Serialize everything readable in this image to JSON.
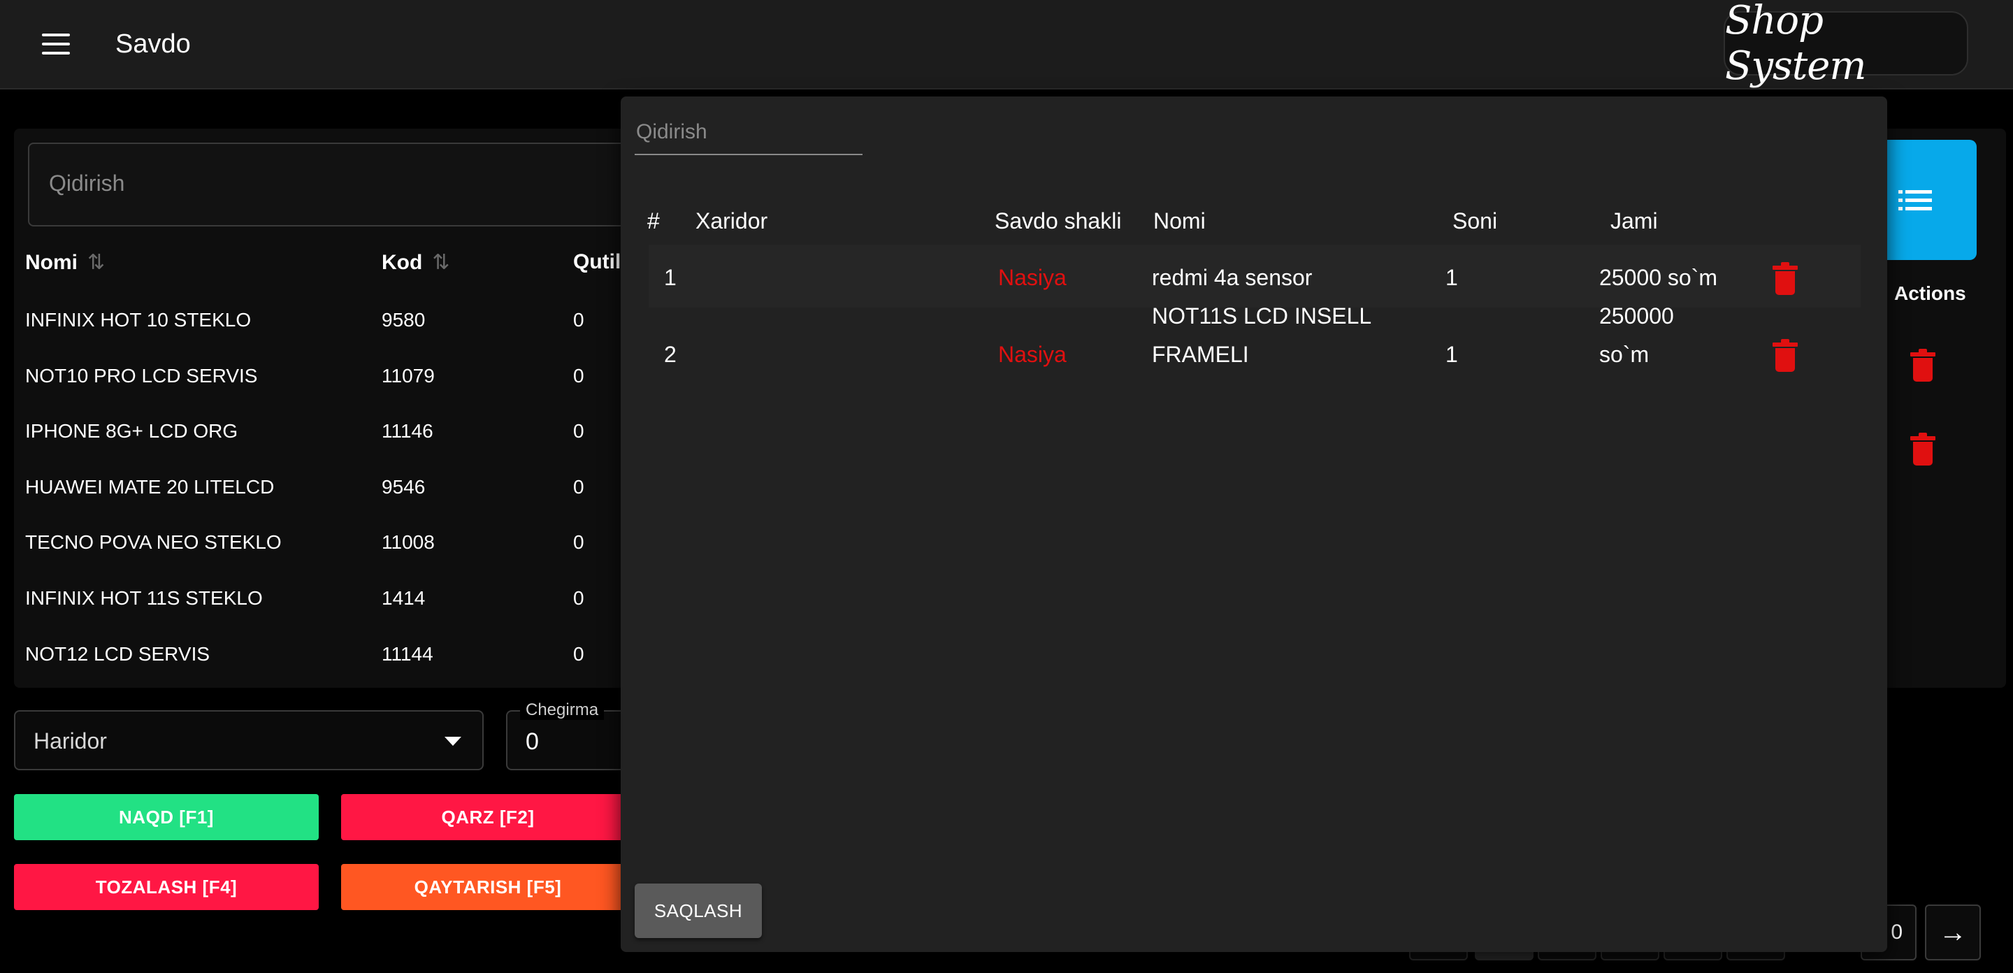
{
  "header": {
    "title": "Savdo",
    "logo_text": "Shop System"
  },
  "products": {
    "search_placeholder": "Qidirish",
    "columns": [
      "Nomi",
      "Kod",
      "Qutil"
    ],
    "rows": [
      {
        "name": "INFINIX HOT 10 STEKLO",
        "code": "9580",
        "qty": "0"
      },
      {
        "name": "NOT10 PRO LCD SERVIS",
        "code": "11079",
        "qty": "0"
      },
      {
        "name": "IPHONE 8G+ LCD ORG",
        "code": "11146",
        "qty": "0"
      },
      {
        "name": "HUAWEI MATE 20 LITELCD",
        "code": "9546",
        "qty": "0"
      },
      {
        "name": "TECNO POVA NEO STEKLO",
        "code": "11008",
        "qty": "0"
      },
      {
        "name": "INFINIX HOT 11S STEKLO",
        "code": "1414",
        "qty": "0"
      },
      {
        "name": "NOT12 LCD SERVIS",
        "code": "11144",
        "qty": "0"
      }
    ]
  },
  "form": {
    "customer_select": "Haridor",
    "discount_label": "Chegirma",
    "discount_value": "0"
  },
  "buttons": {
    "cash": {
      "label": "NAQD [F1]",
      "color": "#22e184"
    },
    "debt": {
      "label": "QARZ [F2]",
      "color": "#ff1744"
    },
    "clear": {
      "label": "TOZALASH [F4]",
      "color": "#ff1744"
    },
    "return": {
      "label": "QAYTARISH [F5]",
      "color": "#ff5722"
    }
  },
  "right_panel": {
    "actions_label": "Actions",
    "accent": "#07a9ea"
  },
  "pagination": {
    "page_value": "0"
  },
  "modal": {
    "search_placeholder": "Qidirish",
    "columns": [
      "#",
      "Xaridor",
      "Savdo shakli",
      "Nomi",
      "Soni",
      "Jami"
    ],
    "rows": [
      {
        "index": "1",
        "customer": "",
        "type": "Nasiya",
        "name": "redmi 4a sensor",
        "name2": "",
        "count": "1",
        "total": "25000 so`m",
        "total2": ""
      },
      {
        "index": "2",
        "customer": "",
        "type": "Nasiya",
        "name": "NOT11S LCD INSELL",
        "name2": "FRAMELI",
        "count": "1",
        "total": "250000",
        "total2": "so`m"
      }
    ],
    "save_label": "SAQLASH",
    "status_color": "#e01010"
  }
}
